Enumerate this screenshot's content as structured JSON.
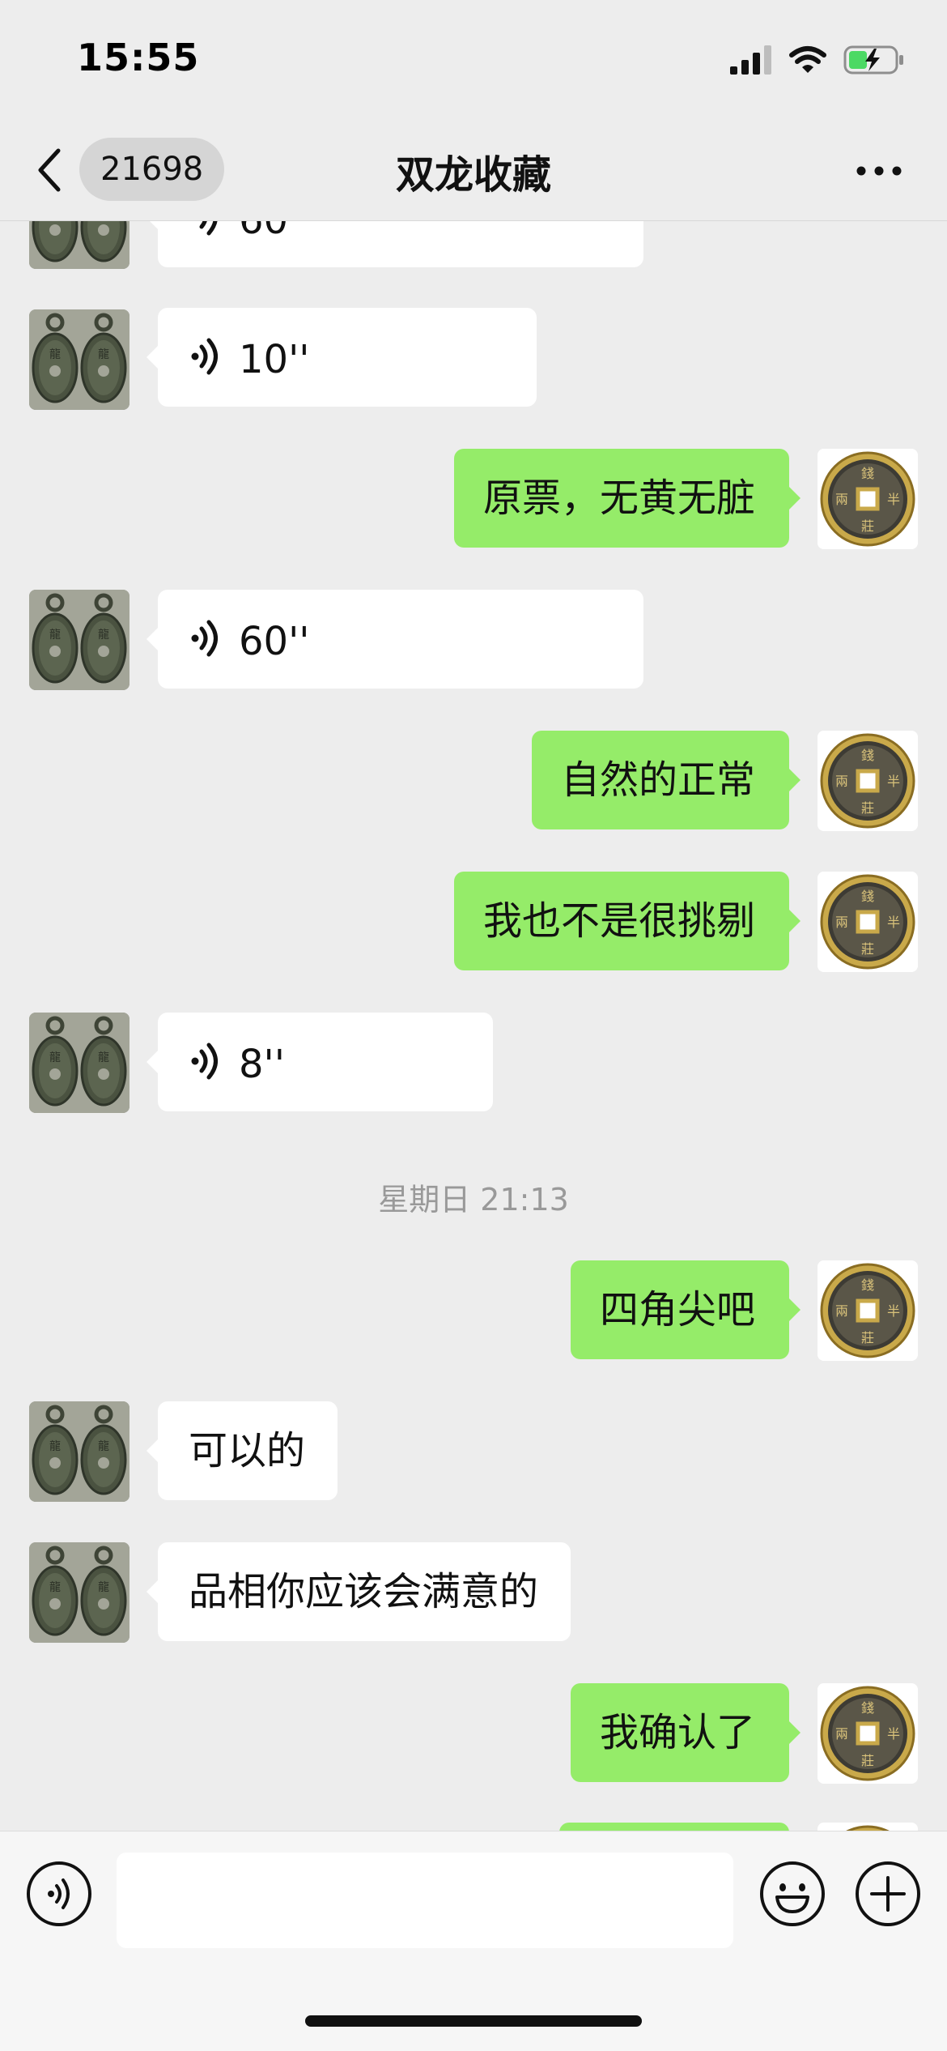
{
  "status_bar": {
    "time": "15:55",
    "icons": [
      "signal-icon",
      "wifi-icon",
      "battery-charging-icon"
    ]
  },
  "nav": {
    "back_icon": "chevron-left-icon",
    "unread_count": "21698",
    "title": "双龙收藏",
    "more_icon": "more-dots-icon"
  },
  "messages": {
    "m0": {
      "sender": "them",
      "type": "voice",
      "duration": "60''"
    },
    "m1": {
      "sender": "them",
      "type": "voice",
      "duration": "10''"
    },
    "m2": {
      "sender": "me",
      "type": "text",
      "text": "原票，无黄无脏"
    },
    "m3": {
      "sender": "them",
      "type": "voice",
      "duration": "60''"
    },
    "m4": {
      "sender": "me",
      "type": "text",
      "text": "自然的正常"
    },
    "m5": {
      "sender": "me",
      "type": "text",
      "text": "我也不是很挑剔"
    },
    "m6": {
      "sender": "them",
      "type": "voice",
      "duration": "8''"
    },
    "timestamp": "星期日 21:13",
    "m7": {
      "sender": "me",
      "type": "text",
      "text": "四角尖吧"
    },
    "m8": {
      "sender": "them",
      "type": "text",
      "text": "可以的"
    },
    "m9": {
      "sender": "them",
      "type": "text",
      "text": "品相你应该会满意的"
    },
    "m10": {
      "sender": "me",
      "type": "text",
      "text": "我确认了"
    }
  },
  "input_bar": {
    "voice_button_icon": "voice-icon",
    "text_value": "",
    "emoji_button_icon": "emoji-icon",
    "plus_button_icon": "plus-icon"
  },
  "colors": {
    "background": "#ededed",
    "bubble_me": "#95ec69",
    "bubble_them": "#ffffff",
    "timestamp_text": "#999999",
    "battery_charge": "#4cd964"
  }
}
